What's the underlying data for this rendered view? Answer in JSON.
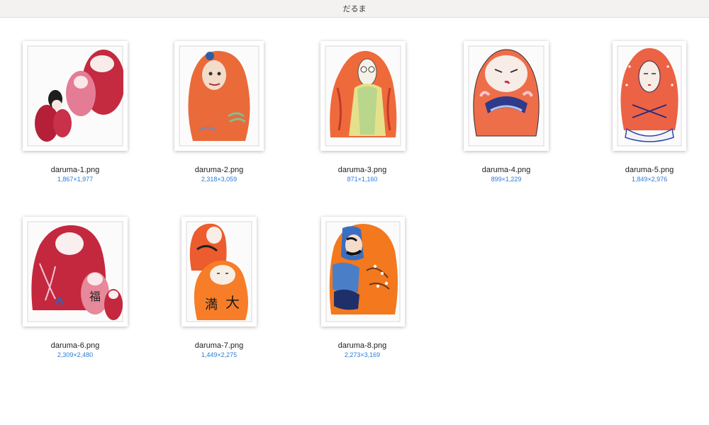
{
  "window": {
    "title": "だるま"
  },
  "accent_color": "#2a7bd6",
  "files": [
    {
      "name": "daruma-1.png",
      "dimensions": "1,867×1,977",
      "icon": "daruma-image-thumbnail"
    },
    {
      "name": "daruma-2.png",
      "dimensions": "2,318×3,059",
      "icon": "daruma-image-thumbnail"
    },
    {
      "name": "daruma-3.png",
      "dimensions": "871×1,160",
      "icon": "daruma-image-thumbnail"
    },
    {
      "name": "daruma-4.png",
      "dimensions": "899×1,229",
      "icon": "daruma-image-thumbnail"
    },
    {
      "name": "daruma-5.png",
      "dimensions": "1,849×2,976",
      "icon": "daruma-image-thumbnail"
    },
    {
      "name": "daruma-6.png",
      "dimensions": "2,309×2,480",
      "icon": "daruma-image-thumbnail"
    },
    {
      "name": "daruma-7.png",
      "dimensions": "1,449×2,275",
      "icon": "daruma-image-thumbnail"
    },
    {
      "name": "daruma-8.png",
      "dimensions": "2,273×3,169",
      "icon": "daruma-image-thumbnail"
    }
  ]
}
